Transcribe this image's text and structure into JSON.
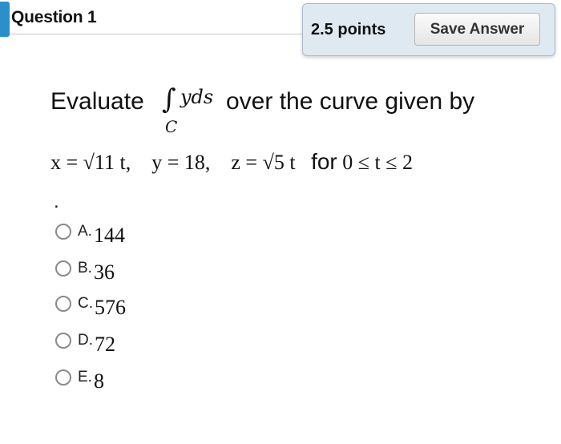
{
  "question": {
    "title": "Question 1"
  },
  "points_panel": {
    "points_label": "2.5 points",
    "save_label": "Save Answer"
  },
  "prompt": {
    "lead": "Evaluate",
    "integral_symbol": "∫",
    "integrand": "yds",
    "subscript": "C",
    "trail": "over the curve given by",
    "equation_parts": [
      "x = √11 t,",
      "y = 18,",
      "z = √5 t"
    ],
    "for_word": "for",
    "range": "0 ≤ t ≤ 2",
    "ending": "."
  },
  "choices": [
    {
      "letter": "A.",
      "value": "144"
    },
    {
      "letter": "B.",
      "value": "36"
    },
    {
      "letter": "C.",
      "value": "576"
    },
    {
      "letter": "D.",
      "value": "72"
    },
    {
      "letter": "E.",
      "value": "8"
    }
  ]
}
